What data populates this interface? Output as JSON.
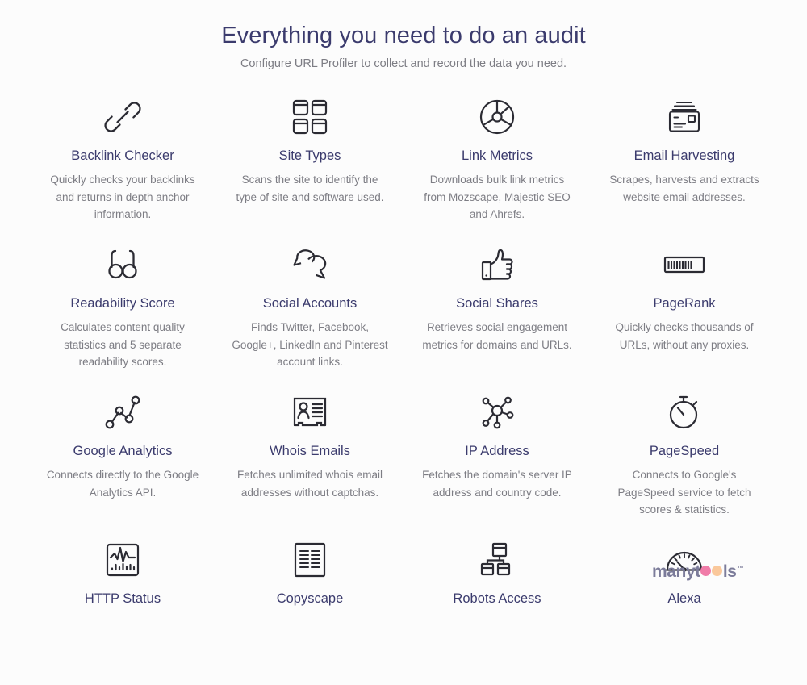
{
  "header": {
    "title": "Everything you need to do an audit",
    "subtitle": "Configure URL Profiler to collect and record the data you need."
  },
  "colors": {
    "background": "#fcfcfc",
    "title": "#3b3b6d",
    "body_text": "#7d7d84",
    "icon_stroke": "#2b2b33",
    "watermark_text": "#7c7c9a",
    "watermark_pink": "#f07ca8",
    "watermark_peach": "#fac89b"
  },
  "features": [
    {
      "icon": "chain-link-icon",
      "title": "Backlink Checker",
      "desc": "Quickly checks your backlinks and returns in depth anchor information."
    },
    {
      "icon": "grid-squares-icon",
      "title": "Site Types",
      "desc": "Scans the site to identify the type of site and software used."
    },
    {
      "icon": "pie-chart-icon",
      "title": "Link Metrics",
      "desc": "Downloads bulk link metrics from Mozscape, Majestic SEO and Ahrefs."
    },
    {
      "icon": "envelope-mail-icon",
      "title": "Email Harvesting",
      "desc": "Scrapes, harvests and extracts website email addresses."
    },
    {
      "icon": "glasses-icon",
      "title": "Readability Score",
      "desc": "Calculates content quality statistics and 5 separate readability scores."
    },
    {
      "icon": "speech-bubbles-icon",
      "title": "Social Accounts",
      "desc": "Finds Twitter, Facebook, Google+, LinkedIn and Pinterest account links."
    },
    {
      "icon": "thumbs-up-icon",
      "title": "Social Shares",
      "desc": "Retrieves social engagement metrics for domains and URLs."
    },
    {
      "icon": "progress-meter-icon",
      "title": "PageRank",
      "desc": "Quickly checks thousands of URLs, without any proxies."
    },
    {
      "icon": "node-graph-icon",
      "title": "Google Analytics",
      "desc": "Connects directly to the Google Analytics API."
    },
    {
      "icon": "id-card-icon",
      "title": "Whois Emails",
      "desc": "Fetches unlimited whois email addresses without captchas."
    },
    {
      "icon": "network-hub-icon",
      "title": "IP Address",
      "desc": "Fetches the domain's server IP address and country code."
    },
    {
      "icon": "stopwatch-icon",
      "title": "PageSpeed",
      "desc": "Connects to Google's PageSpeed service to fetch scores & statistics."
    },
    {
      "icon": "monitor-chart-icon",
      "title": "HTTP Status",
      "desc": ""
    },
    {
      "icon": "document-text-icon",
      "title": "Copyscape",
      "desc": ""
    },
    {
      "icon": "sitemap-icon",
      "title": "Robots Access",
      "desc": ""
    },
    {
      "icon": "gauge-icon",
      "title": "Alexa",
      "desc": ""
    }
  ],
  "watermark": {
    "prefix": "manyt",
    "suffix": "ls",
    "tm": "™"
  }
}
